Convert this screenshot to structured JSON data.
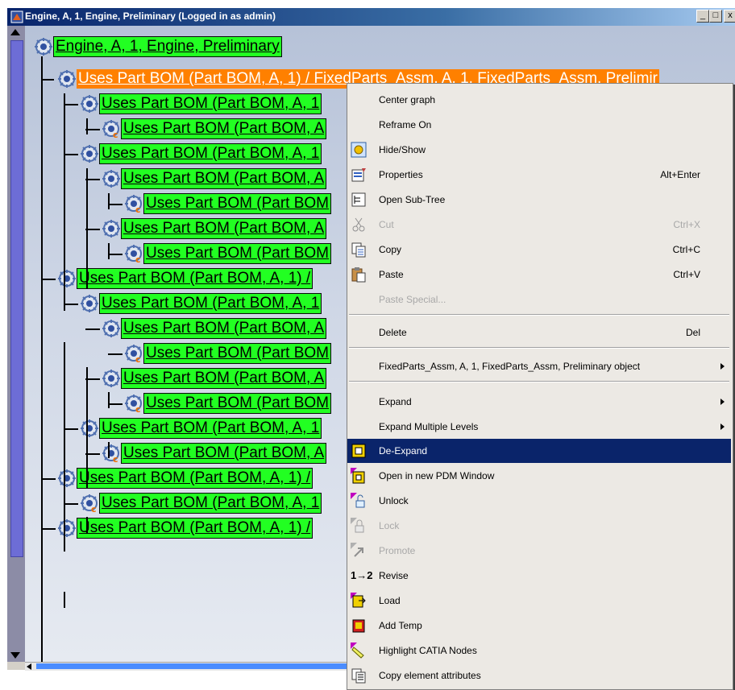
{
  "window": {
    "title": "Engine, A, 1, Engine, Preliminary (Logged in as admin)",
    "buttons": [
      "_",
      "□",
      "x"
    ]
  },
  "tree": {
    "root_label": "Engine, A, 1, Engine, Preliminary",
    "selected_label": "Uses Part BOM (Part BOM, A, 1) / FixedParts_Assm, A, 1, FixedParts_Assm, Prelimir",
    "nodes": [
      {
        "label": "Uses Part BOM (Part BOM, A, 1"
      },
      {
        "label": "Uses Part BOM (Part BOM, A"
      },
      {
        "label": "Uses Part BOM (Part BOM, A, 1"
      },
      {
        "label": "Uses Part BOM (Part BOM, A"
      },
      {
        "label": "Uses Part BOM (Part BOM"
      },
      {
        "label": "Uses Part BOM (Part BOM, A"
      },
      {
        "label": "Uses Part BOM (Part BOM"
      },
      {
        "label": "Uses Part BOM (Part BOM, A, 1) /"
      },
      {
        "label": "Uses Part BOM (Part BOM, A, 1"
      },
      {
        "label": "Uses Part BOM (Part BOM, A"
      },
      {
        "label": "Uses Part BOM (Part BOM"
      },
      {
        "label": "Uses Part BOM (Part BOM, A"
      },
      {
        "label": "Uses Part BOM (Part BOM"
      },
      {
        "label": "Uses Part BOM (Part BOM, A, 1"
      },
      {
        "label": "Uses Part BOM (Part BOM, A"
      },
      {
        "label": "Uses Part BOM (Part BOM, A, 1) /"
      },
      {
        "label": "Uses Part BOM (Part BOM, A, 1"
      },
      {
        "label": "Uses Part BOM (Part BOM, A, 1) /"
      }
    ]
  },
  "menu": {
    "center_graph": "Center graph",
    "reframe_on": "Reframe On",
    "hide_show": "Hide/Show",
    "properties": "Properties",
    "properties_sc": "Alt+Enter",
    "open_sub_tree": "Open Sub-Tree",
    "cut": "Cut",
    "cut_sc": "Ctrl+X",
    "copy": "Copy",
    "copy_sc": "Ctrl+C",
    "paste": "Paste",
    "paste_sc": "Ctrl+V",
    "paste_special": "Paste Special...",
    "delete": "Delete",
    "delete_sc": "Del",
    "object": "FixedParts_Assm, A, 1, FixedParts_Assm, Preliminary object",
    "expand": "Expand",
    "expand_multiple": "Expand Multiple Levels",
    "de_expand": "De-Expand",
    "open_new_pdm": "Open in new PDM Window",
    "unlock": "Unlock",
    "lock": "Lock",
    "promote": "Promote",
    "revise": "Revise",
    "revise_icon_text": "1→2",
    "load": "Load",
    "add_temp": "Add Temp",
    "highlight_catia": "Highlight CATIA Nodes",
    "copy_attributes": "Copy element attributes"
  },
  "colors": {
    "node_green": "#22ff22",
    "node_selected": "#ff8000",
    "menu_highlight": "#0a246a"
  }
}
